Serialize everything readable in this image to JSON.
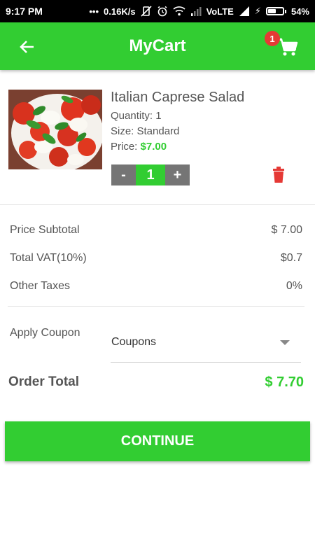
{
  "status_bar": {
    "time": "9:17 PM",
    "net_speed": "0.16K/s",
    "network": "VoLTE",
    "battery": "54%",
    "battery_level": 0.54
  },
  "app_bar": {
    "title": "MyCart",
    "back_icon": "arrow-left-icon",
    "cart_icon": "shopping-cart-icon",
    "cart_count": "1"
  },
  "product": {
    "name": "Italian Caprese Salad",
    "quantity_text": "Quantity: 1",
    "size_text": "Size: Standard",
    "price_label": "Price: ",
    "price_value": "$7.00",
    "stepper": {
      "minus": "-",
      "value": "1",
      "plus": "+"
    },
    "delete_icon": "trash-icon"
  },
  "summary": {
    "subtotal_label": "Price Subtotal",
    "subtotal_value": "$ 7.00",
    "vat_label": "Total VAT(10%)",
    "vat_value": "$0.7",
    "other_label": "Other Taxes",
    "other_value": "0%"
  },
  "coupon": {
    "label": "Apply Coupon",
    "selected": "Coupons"
  },
  "order_total": {
    "label": "Order Total",
    "value": "$ 7.70"
  },
  "continue_label": "CONTINUE",
  "colors": {
    "accent": "#32cd32",
    "badge": "#e53935",
    "delete": "#e53935",
    "stepper_grey": "#757575"
  }
}
